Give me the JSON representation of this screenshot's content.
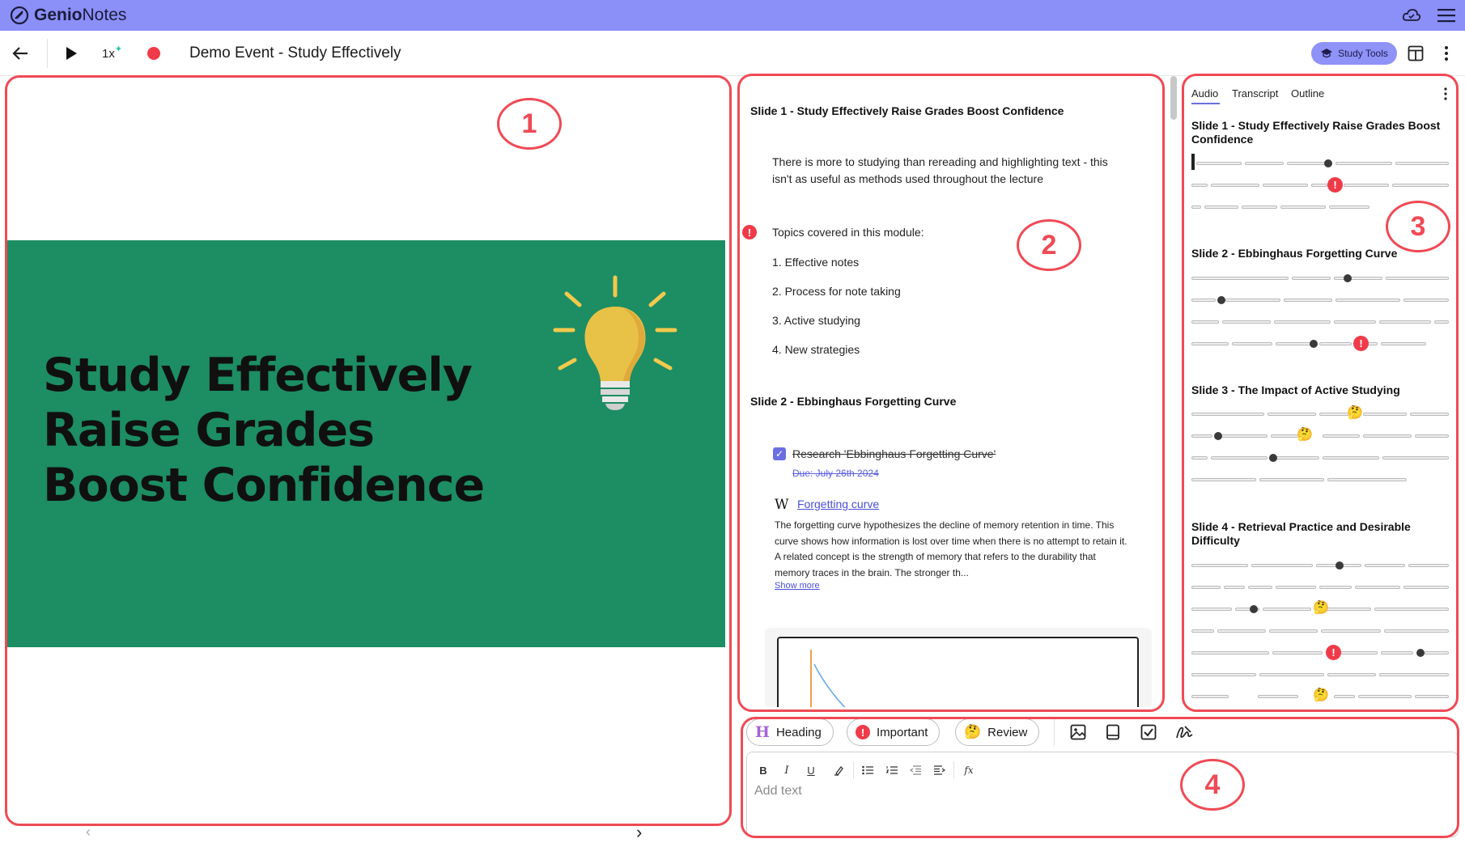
{
  "app": {
    "brand_genio": "Genio",
    "brand_notes": "Notes"
  },
  "toolbar": {
    "speed_label": "1x",
    "title": "Demo Event - Study Effectively",
    "study_tools_label": "Study Tools"
  },
  "slide": {
    "title_lines": [
      "Study Effectively",
      "Raise Grades",
      "Boost Confidence"
    ]
  },
  "callouts": {
    "one": "1",
    "two": "2",
    "three": "3",
    "four": "4"
  },
  "notes": {
    "slide1_heading": "Slide 1 - Study Effectively Raise Grades Boost Confidence",
    "slide1_para": "There is more to studying than rereading and highlighting text - this isn't as useful as methods used throughout the lecture",
    "topics_heading": "Topics covered in this module:",
    "topics": [
      "1. Effective notes",
      "2. Process for note taking",
      "3. Active studying",
      "4. New strategies"
    ],
    "slide2_heading": "Slide 2 - Ebbinghaus Forgetting Curve",
    "task_label": "Research 'Ebbinghaus Forgetting Curve'",
    "task_due": "Due: July 26th 2024",
    "wiki_letter": "W",
    "wiki_link": "Forgetting curve",
    "wiki_text": "The forgetting curve hypothesizes the decline of memory retention in time. This curve shows how information is lost over time when there is no attempt to retain it. A related concept is the strength of memory that refers to the durability that memory traces in the brain. The stronger th...",
    "show_more": "Show more"
  },
  "outline": {
    "tabs": [
      "Audio",
      "Transcript",
      "Outline"
    ],
    "active_tab": "Audio",
    "headings": [
      "Slide 1 - Study Effectively Raise Grades Boost Confidence",
      "Slide 2 - Ebbinghaus Forgetting Curve",
      "Slide 3 - The Impact of Active Studying",
      "Slide 4 - Retrieval Practice and Desirable Difficulty"
    ]
  },
  "editor": {
    "heading_label": "Heading",
    "important_label": "Important",
    "review_label": "Review",
    "placeholder": "Add text"
  },
  "colors": {
    "accent": "#8b8ff8",
    "slide_green": "#1d8d63",
    "callout": "#ef4a55",
    "important": "#ef3b49"
  }
}
